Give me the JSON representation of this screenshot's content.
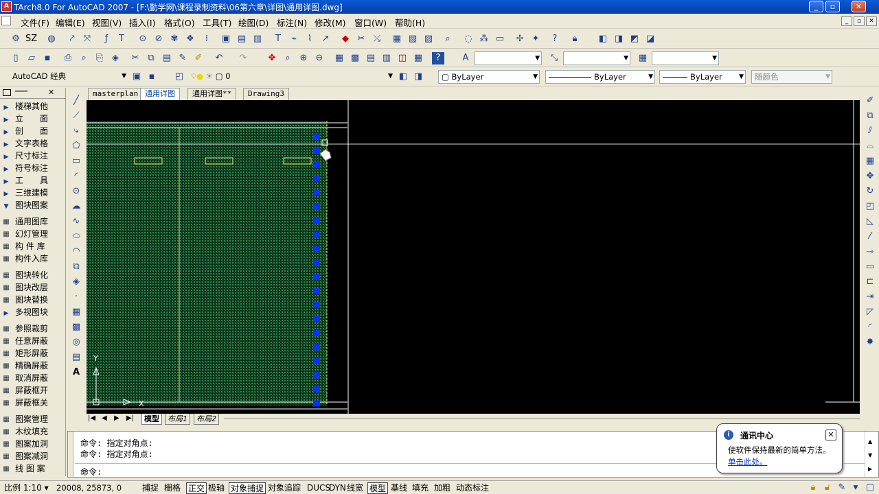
{
  "window": {
    "title": "TArch8.0 For AutoCAD 2007 - [F:\\勤学网\\课程录制资料\\06第六章\\详图\\通用详图.dwg]"
  },
  "menu": [
    "文件(F)",
    "编辑(E)",
    "视图(V)",
    "插入(I)",
    "格式(O)",
    "工具(T)",
    "绘图(D)",
    "标注(N)",
    "修改(M)",
    "窗口(W)",
    "帮助(H)"
  ],
  "toolbar1": {
    "sz_label": "SZ"
  },
  "toolbar3": {
    "workspace": "AutoCAD 经典",
    "layer": "0",
    "color": "ByLayer",
    "linetype": "ByLayer",
    "lineweight": "ByLayer",
    "plotstyle": "随颜色"
  },
  "left_panel": {
    "items": [
      {
        "label": "楼梯其他",
        "kind": "arrow"
      },
      {
        "label": "立　　面",
        "kind": "arrow"
      },
      {
        "label": "剖　　面",
        "kind": "arrow"
      },
      {
        "label": "文字表格",
        "kind": "arrow"
      },
      {
        "label": "尺寸标注",
        "kind": "arrow"
      },
      {
        "label": "符号标注",
        "kind": "arrow"
      },
      {
        "label": "工　　具",
        "kind": "arrow"
      },
      {
        "label": "三维建模",
        "kind": "arrow"
      },
      {
        "label": "图块图案",
        "kind": "open"
      },
      {
        "label": "通用图库",
        "kind": "icon"
      },
      {
        "label": "幻灯管理",
        "kind": "icon"
      },
      {
        "label": "构 件 库",
        "kind": "icon"
      },
      {
        "label": "构件入库",
        "kind": "icon"
      },
      {
        "label": "图块转化",
        "kind": "icon"
      },
      {
        "label": "图块改层",
        "kind": "icon"
      },
      {
        "label": "图块替换",
        "kind": "icon"
      },
      {
        "label": "多视图块",
        "kind": "arrow"
      },
      {
        "label": "参照裁剪",
        "kind": "icon"
      },
      {
        "label": "任意屏蔽",
        "kind": "icon"
      },
      {
        "label": "矩形屏蔽",
        "kind": "icon"
      },
      {
        "label": "精确屏蔽",
        "kind": "icon"
      },
      {
        "label": "取消屏蔽",
        "kind": "icon"
      },
      {
        "label": "屏蔽框开",
        "kind": "icon"
      },
      {
        "label": "屏蔽框关",
        "kind": "icon"
      },
      {
        "label": "图案管理",
        "kind": "icon"
      },
      {
        "label": "木纹填充",
        "kind": "icon"
      },
      {
        "label": "图案加洞",
        "kind": "icon"
      },
      {
        "label": "图案减洞",
        "kind": "icon"
      },
      {
        "label": "线 图 案",
        "kind": "icon"
      }
    ]
  },
  "doc_tabs": [
    "masterplan",
    "通用详图",
    "通用详图**",
    "Drawing3"
  ],
  "layout_tabs": [
    "模型",
    "布局1",
    "布局2"
  ],
  "axis": {
    "y": "Y",
    "x": "X"
  },
  "command": {
    "lines": [
      "命令: 指定对角点:",
      "命令: 指定对角点:"
    ],
    "prompt": "命令:"
  },
  "status": {
    "scale": "比例 1:10",
    "coords": "20008, 25873, 0",
    "toggles": [
      {
        "label": "捕捉",
        "on": false
      },
      {
        "label": "栅格",
        "on": false
      },
      {
        "label": "正交",
        "on": true
      },
      {
        "label": "极轴",
        "on": false
      },
      {
        "label": "对象捕捉",
        "on": true
      },
      {
        "label": "对象追踪",
        "on": false
      },
      {
        "label": "DUCS",
        "on": false
      },
      {
        "label": "DYN",
        "on": false
      },
      {
        "label": "线宽",
        "on": false
      },
      {
        "label": "模型",
        "on": true
      },
      {
        "label": "基线",
        "on": false
      },
      {
        "label": "填充",
        "on": false
      },
      {
        "label": "加粗",
        "on": false
      },
      {
        "label": "动态标注",
        "on": false
      }
    ]
  },
  "balloon": {
    "title": "通讯中心",
    "body": "使软件保持最新的简单方法。",
    "link": "单击此处。"
  },
  "colors": {
    "titlebar": "#0a5ad8",
    "hatch": "#1b6b3a",
    "grip": "#0033ff",
    "rect": "#e8e85a"
  }
}
